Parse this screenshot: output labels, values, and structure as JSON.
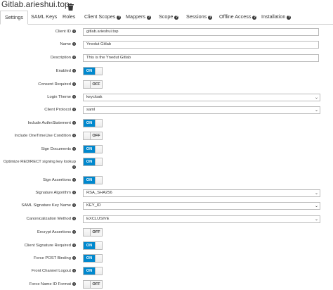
{
  "header": {
    "title": "Gitlab.arieshui.top",
    "icon": "trash-icon"
  },
  "tabs": [
    {
      "label": "Settings",
      "help": false
    },
    {
      "label": "SAML Keys",
      "help": false
    },
    {
      "label": "Roles",
      "help": false
    },
    {
      "label": "Client Scopes",
      "help": true
    },
    {
      "label": "Mappers",
      "help": true
    },
    {
      "label": "Scope",
      "help": true
    },
    {
      "label": "Sessions",
      "help": true
    },
    {
      "label": "Offline Access",
      "help": true
    },
    {
      "label": "Installation",
      "help": true
    }
  ],
  "help_glyph": "?",
  "form": {
    "client_id": {
      "label": "Client ID",
      "value": "gitlab.arieshui.top"
    },
    "name": {
      "label": "Name",
      "value": "Ynedut Gitlab"
    },
    "description": {
      "label": "Description",
      "value": "This is the Ynedut Gitlab"
    },
    "enabled": {
      "label": "Enabled",
      "state": "ON"
    },
    "consent_required": {
      "label": "Consent Required",
      "state": "OFF"
    },
    "login_theme": {
      "label": "Login Theme",
      "value": "keycloak"
    },
    "client_protocol": {
      "label": "Client Protocol",
      "value": "saml"
    },
    "include_authn_statement": {
      "label": "Include AuthnStatement",
      "state": "ON"
    },
    "include_onetimeuse": {
      "label": "Include OneTimeUse Condition",
      "state": "OFF"
    },
    "sign_documents": {
      "label": "Sign Documents",
      "state": "ON"
    },
    "optimize_redirect": {
      "label": "Optimize REDIRECT signing key lookup",
      "state": "ON"
    },
    "sign_assertions": {
      "label": "Sign Assertions",
      "state": "ON"
    },
    "signature_algorithm": {
      "label": "Signature Algorithm",
      "value": "RSA_SHA256"
    },
    "saml_signature_key_name": {
      "label": "SAML Signature Key Name",
      "value": "KEY_ID"
    },
    "canonicalization_method": {
      "label": "Canonicalization Method",
      "value": "EXCLUSIVE"
    },
    "encrypt_assertions": {
      "label": "Encrypt Assertions",
      "state": "OFF"
    },
    "client_signature_required": {
      "label": "Client Signature Required",
      "state": "ON"
    },
    "force_post_binding": {
      "label": "Force POST Binding",
      "state": "ON"
    },
    "front_channel_logout": {
      "label": "Front Channel Logout",
      "state": "ON"
    },
    "force_name_id_format": {
      "label": "Force Name ID Format",
      "state": "OFF"
    }
  },
  "colors": {
    "switch_on": "#0088ce",
    "border": "#bbbbbb",
    "text": "#363636"
  }
}
